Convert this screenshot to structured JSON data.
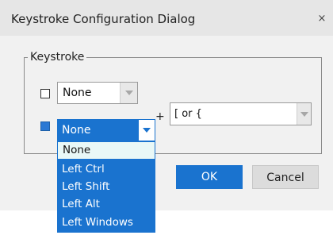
{
  "window": {
    "title": "Keystroke Configuration Dialog",
    "close_glyph": "×"
  },
  "group": {
    "legend": "Keystroke"
  },
  "row1": {
    "checked": false,
    "select_value": "None"
  },
  "row2": {
    "checked": true,
    "select_value": "None",
    "expanded": true
  },
  "plus_label": "+",
  "key_select": {
    "value": "[ or {"
  },
  "dropdown": {
    "options": [
      "None",
      "Left Ctrl",
      "Left Shift",
      "Left Alt",
      "Left Windows"
    ],
    "highlighted": "None"
  },
  "buttons": {
    "ok": "OK",
    "cancel": "Cancel"
  },
  "colors": {
    "accent": "#1a73cf",
    "highlight": "#e9f8f7",
    "dialog_bg": "#f1f1f1"
  }
}
